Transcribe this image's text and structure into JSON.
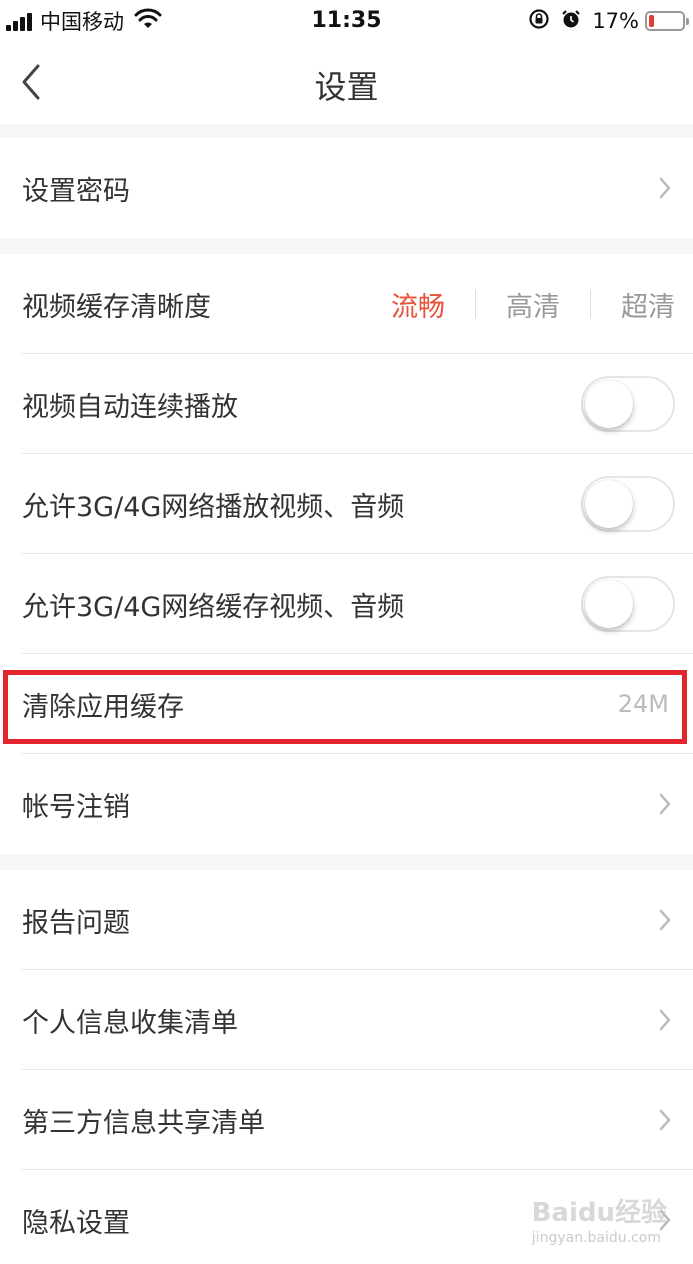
{
  "status_bar": {
    "carrier": "中国移动",
    "time": "11:35",
    "battery": "17%",
    "battery_level": 0.17,
    "icons": [
      "signal-icon",
      "wifi-icon",
      "rotation-lock-icon",
      "alarm-icon",
      "battery-icon"
    ]
  },
  "nav": {
    "title": "设置",
    "back_icon": "chevron-left-icon"
  },
  "group1": {
    "set_password": "设置密码"
  },
  "group2": {
    "video_quality_label": "视频缓存清晰度",
    "quality_options": [
      "流畅",
      "高清",
      "超清"
    ],
    "quality_selected": "流畅",
    "autoplay_label": "视频自动连续播放",
    "autoplay_on": false,
    "cellular_play_label": "允许3G/4G网络播放视频、音频",
    "cellular_play_on": false,
    "cellular_cache_label": "允许3G/4G网络缓存视频、音频",
    "cellular_cache_on": false,
    "clear_cache_label": "清除应用缓存",
    "cache_size": "24M",
    "account_cancel_label": "帐号注销"
  },
  "group3": {
    "report_label": "报告问题",
    "personal_info_label": "个人信息收集清单",
    "third_party_label": "第三方信息共享清单",
    "privacy_label": "隐私设置"
  },
  "colors": {
    "accent": "#e8533a",
    "highlight_box": "#e0252d",
    "battery_low": "#e53a30"
  },
  "watermark": {
    "brand": "Baidu经验",
    "url": "jingyan.baidu.com"
  }
}
